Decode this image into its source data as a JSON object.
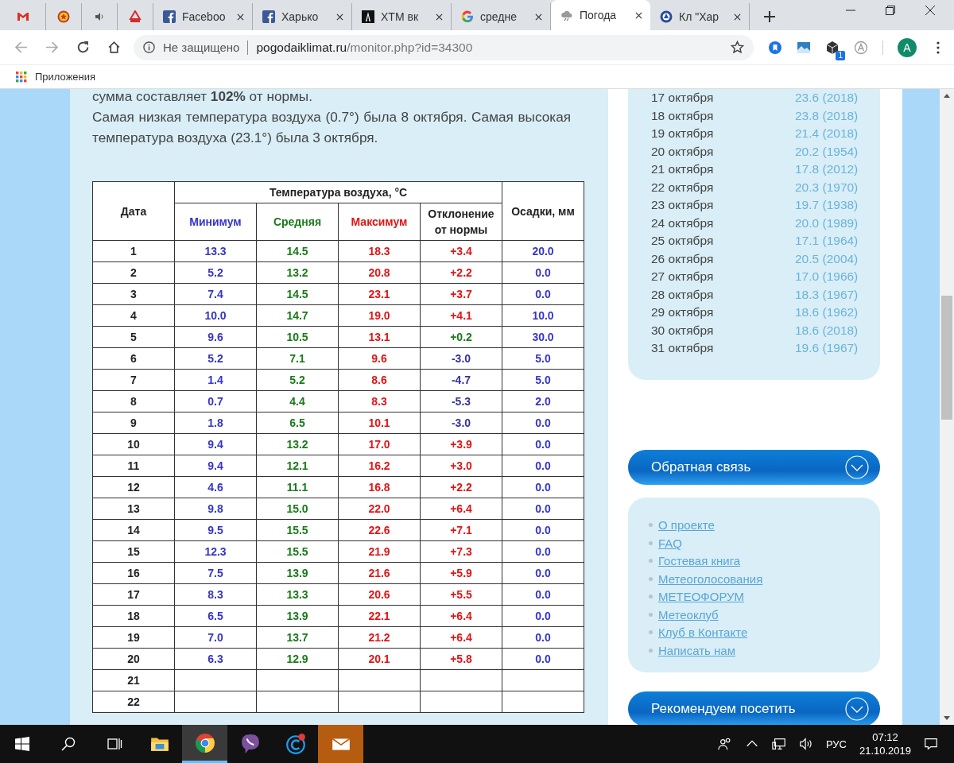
{
  "browser": {
    "tabs": [
      {
        "kind": "pinned",
        "selected": false
      },
      {
        "kind": "pinned",
        "selected": false
      },
      {
        "kind": "pinned",
        "selected": false
      },
      {
        "kind": "pinned",
        "selected": false
      },
      {
        "kind": "normal",
        "title": "Faceboo",
        "selected": false
      },
      {
        "kind": "normal",
        "title": "Харько",
        "selected": false
      },
      {
        "kind": "normal",
        "title": "ХТМ вк",
        "selected": false
      },
      {
        "kind": "normal",
        "title": "средне",
        "selected": false
      },
      {
        "kind": "normal",
        "title": "Погода",
        "selected": true
      },
      {
        "kind": "normal",
        "title": "Кл \"Хар",
        "selected": false
      }
    ],
    "address": {
      "security": "Не защищено",
      "domain": "pogodaiklimat.ru",
      "path": "/monitor.php?id=34300"
    },
    "extension_badge": "1",
    "profile_initial": "A",
    "bookmarks": [
      "Приложения"
    ]
  },
  "page": {
    "summary_lines": [
      "сумма составляет **102%** от нормы.",
      "Самая низкая температура воздуха (0.7°) была 8 октября. Самая высокая температура воздуха (23.1°) была 3 октября."
    ],
    "table": {
      "date_header": "Дата",
      "group_header": "Температура воздуха, °C",
      "precip_header": "Осадки, мм",
      "columns": [
        {
          "label": "Минимум",
          "color": "#3535c8"
        },
        {
          "label": "Средняя",
          "color": "#1a7a1a"
        },
        {
          "label": "Максимум",
          "color": "#e01515"
        },
        {
          "label": "Отклонение от нормы",
          "color": "#222222"
        }
      ],
      "rows": [
        {
          "day": "1",
          "min": "13.3",
          "mean": "14.5",
          "max": "18.3",
          "deviation": "+3.4",
          "color": "#e01515",
          "precip": "20.0"
        },
        {
          "day": "2",
          "min": "5.2",
          "mean": "13.2",
          "max": "20.8",
          "deviation": "+2.2",
          "color": "#e01515",
          "precip": "0.0"
        },
        {
          "day": "3",
          "min": "7.4",
          "mean": "14.5",
          "max": "23.1",
          "deviation": "+3.7",
          "color": "#e01515",
          "precip": "0.0"
        },
        {
          "day": "4",
          "min": "10.0",
          "mean": "14.7",
          "max": "19.0",
          "deviation": "+4.1",
          "color": "#e01515",
          "precip": "10.0"
        },
        {
          "day": "5",
          "min": "9.6",
          "mean": "10.5",
          "max": "13.1",
          "deviation": "+0.2",
          "color": "#1a7a1a",
          "precip": "30.0"
        },
        {
          "day": "6",
          "min": "5.2",
          "mean": "7.1",
          "max": "9.6",
          "deviation": "-3.0",
          "color": "#333399",
          "precip": "5.0"
        },
        {
          "day": "7",
          "min": "1.4",
          "mean": "5.2",
          "max": "8.6",
          "deviation": "-4.7",
          "color": "#333399",
          "precip": "5.0"
        },
        {
          "day": "8",
          "min": "0.7",
          "mean": "4.4",
          "max": "8.3",
          "deviation": "-5.3",
          "color": "#333399",
          "precip": "2.0"
        },
        {
          "day": "9",
          "min": "1.8",
          "mean": "6.5",
          "max": "10.1",
          "deviation": "-3.0",
          "color": "#333399",
          "precip": "0.0"
        },
        {
          "day": "10",
          "min": "9.4",
          "mean": "13.2",
          "max": "17.0",
          "deviation": "+3.9",
          "color": "#e01515",
          "precip": "0.0"
        },
        {
          "day": "11",
          "min": "9.4",
          "mean": "12.1",
          "max": "16.2",
          "deviation": "+3.0",
          "color": "#e01515",
          "precip": "0.0"
        },
        {
          "day": "12",
          "min": "4.6",
          "mean": "11.1",
          "max": "16.8",
          "deviation": "+2.2",
          "color": "#e01515",
          "precip": "0.0"
        },
        {
          "day": "13",
          "min": "9.8",
          "mean": "15.0",
          "max": "22.0",
          "deviation": "+6.4",
          "color": "#e01515",
          "precip": "0.0"
        },
        {
          "day": "14",
          "min": "9.5",
          "mean": "15.5",
          "max": "22.6",
          "deviation": "+7.1",
          "color": "#e01515",
          "precip": "0.0"
        },
        {
          "day": "15",
          "min": "12.3",
          "mean": "15.5",
          "max": "21.9",
          "deviation": "+7.3",
          "color": "#e01515",
          "precip": "0.0"
        },
        {
          "day": "16",
          "min": "7.5",
          "mean": "13.9",
          "max": "21.6",
          "deviation": "+5.9",
          "color": "#e01515",
          "precip": "0.0"
        },
        {
          "day": "17",
          "min": "8.3",
          "mean": "13.3",
          "max": "20.6",
          "deviation": "+5.5",
          "color": "#e01515",
          "precip": "0.0"
        },
        {
          "day": "18",
          "min": "6.5",
          "mean": "13.9",
          "max": "22.1",
          "deviation": "+6.4",
          "color": "#e01515",
          "precip": "0.0"
        },
        {
          "day": "19",
          "min": "7.0",
          "mean": "13.7",
          "max": "21.2",
          "deviation": "+6.4",
          "color": "#e01515",
          "precip": "0.0"
        },
        {
          "day": "20",
          "min": "6.3",
          "mean": "12.9",
          "max": "20.1",
          "deviation": "+5.8",
          "color": "#e01515",
          "precip": "0.0"
        },
        {
          "day": "21"
        },
        {
          "day": "22"
        }
      ]
    }
  },
  "sidebar": {
    "records": [
      {
        "date": "17 октября",
        "value": "23.6 (2018)"
      },
      {
        "date": "18 октября",
        "value": "23.8 (2018)"
      },
      {
        "date": "19 октября",
        "value": "21.4 (2018)"
      },
      {
        "date": "20 октября",
        "value": "20.2 (1954)"
      },
      {
        "date": "21 октября",
        "value": "17.8 (2012)"
      },
      {
        "date": "22 октября",
        "value": "20.3 (1970)"
      },
      {
        "date": "23 октября",
        "value": "19.7 (1938)"
      },
      {
        "date": "24 октября",
        "value": "20.0 (1989)"
      },
      {
        "date": "25 октября",
        "value": "17.1 (1964)"
      },
      {
        "date": "26 октября",
        "value": "20.5 (2004)"
      },
      {
        "date": "27 октября",
        "value": "17.0 (1966)"
      },
      {
        "date": "28 октября",
        "value": "18.3 (1967)"
      },
      {
        "date": "29 октября",
        "value": "18.6 (1962)"
      },
      {
        "date": "30 октября",
        "value": "18.6 (2018)"
      },
      {
        "date": "31 октября",
        "value": "19.6 (1967)"
      }
    ],
    "feedback_title": "Обратная связь",
    "links": [
      "О проекте",
      "FAQ",
      "Гостевая книга",
      "Метеоголосования",
      "МЕТЕОФОРУМ",
      "Метеоклуб",
      "Клуб в Контакте",
      "Написать нам"
    ],
    "recommend_title": "Рекомендуем посетить"
  },
  "taskbar": {
    "apps": [
      {
        "active": false,
        "highlighted": false
      },
      {
        "active": true,
        "highlighted": false
      },
      {
        "active": false,
        "highlighted": false
      },
      {
        "active": false,
        "highlighted": false
      },
      {
        "active": false,
        "highlighted": true
      }
    ],
    "language": "РУС",
    "time": "07:12",
    "date": "21.10.2019"
  }
}
